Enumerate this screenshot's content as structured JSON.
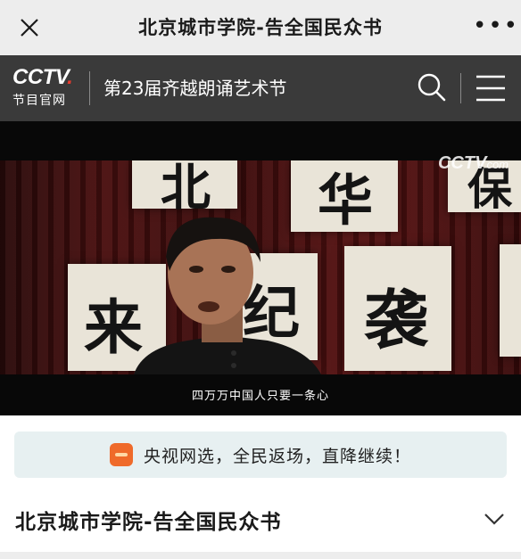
{
  "topbar": {
    "title": "北京城市学院-告全国民众书",
    "more_label": "•••"
  },
  "cctv_header": {
    "logo_main": "CCTV",
    "logo_dot": ".",
    "logo_sub": "节目官网",
    "title": "第23届齐越朗诵艺术节"
  },
  "video": {
    "subtitle": "四万万中国人只要一条心",
    "watermark_main": "CCTV",
    "watermark_suffix": "com",
    "banner_glyphs": [
      "北",
      "华",
      "保",
      "来",
      "纪",
      "袭"
    ]
  },
  "promo": {
    "text": "央视网选，全民返场，直降继续！",
    "icon": "cctv-shop-icon",
    "icon_color": "#ef6a2a"
  },
  "article": {
    "title": "北京城市学院-告全国民众书"
  },
  "colors": {
    "topbar_bg": "#ededed",
    "header_bg": "#3a3a3a",
    "logo_accent": "#e63b2e",
    "promo_bg": "#e7f0f1"
  }
}
